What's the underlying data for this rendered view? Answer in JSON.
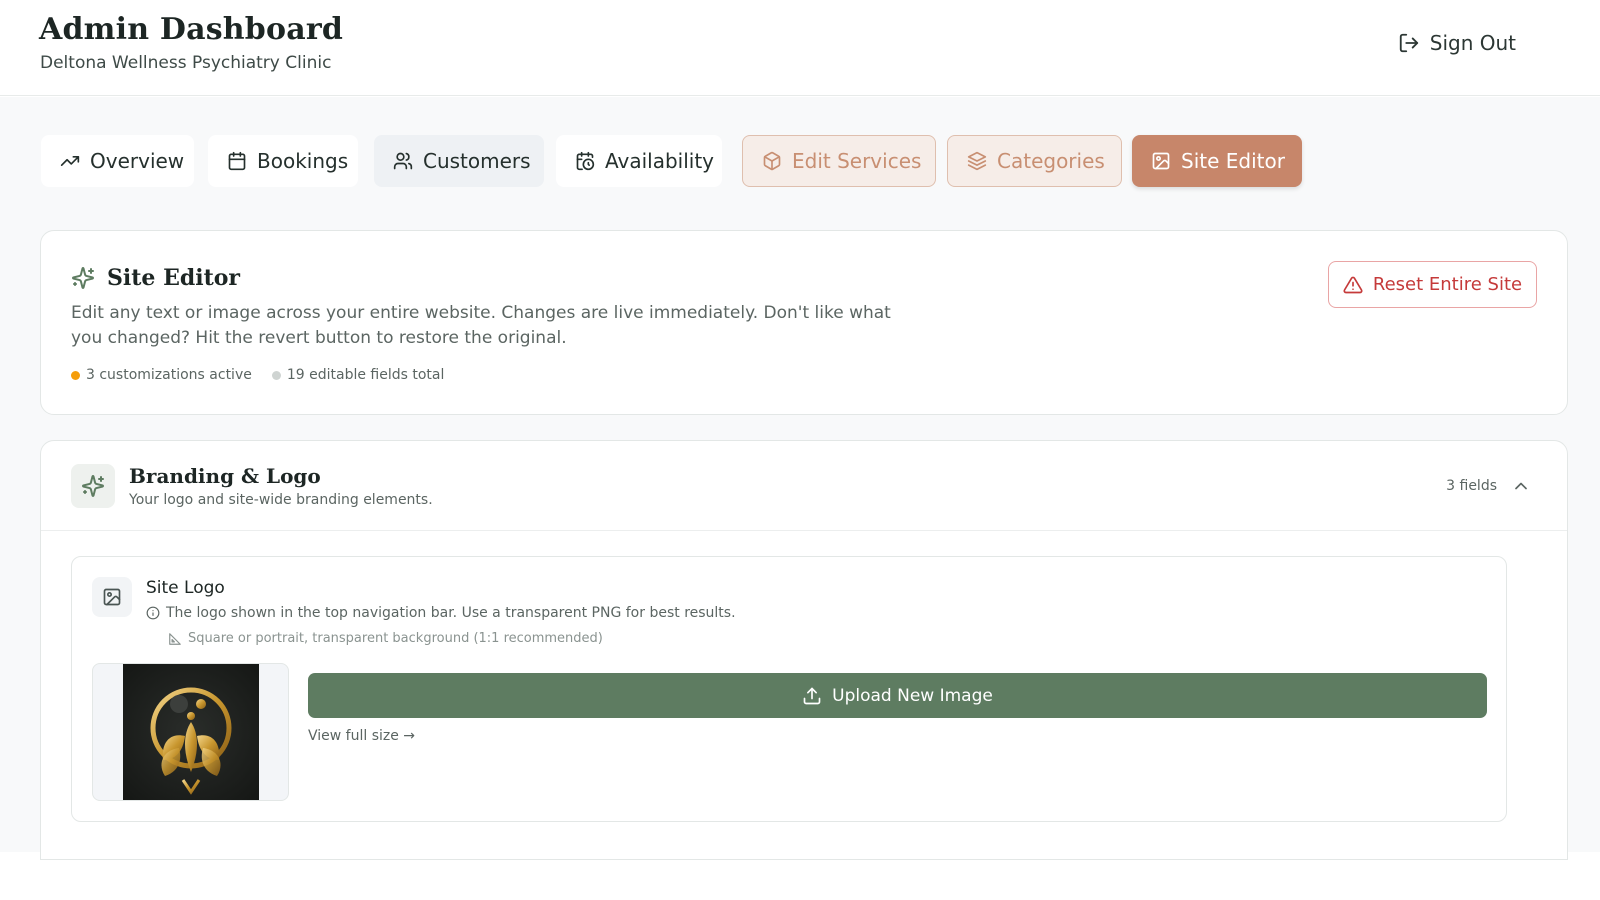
{
  "header": {
    "title": "Admin Dashboard",
    "subtitle": "Deltona Wellness Psychiatry Clinic",
    "sign_out_label": "Sign Out"
  },
  "tabs": [
    {
      "label": "Overview",
      "icon": "trending-up-icon",
      "state": "default"
    },
    {
      "label": "Bookings",
      "icon": "calendar-icon",
      "state": "default"
    },
    {
      "label": "Customers",
      "icon": "users-icon",
      "state": "hover"
    },
    {
      "label": "Availability",
      "icon": "calendar-clock-icon",
      "state": "default"
    },
    {
      "label": "Edit Services",
      "icon": "package-icon",
      "state": "tinted"
    },
    {
      "label": "Categories",
      "icon": "layers-icon",
      "state": "tinted"
    },
    {
      "label": "Site Editor",
      "icon": "image-icon",
      "state": "active"
    }
  ],
  "site_editor": {
    "title": "Site Editor",
    "description": "Edit any text or image across your entire website. Changes are live immediately. Don't like what you changed? Hit the revert button to restore the original.",
    "stats": {
      "customizations": "3 customizations active",
      "fields_total": "19 editable fields total"
    },
    "reset_label": "Reset Entire Site"
  },
  "branding": {
    "title": "Branding & Logo",
    "subtitle": "Your logo and site-wide branding elements.",
    "field_count": "3 fields",
    "fields": {
      "site_logo": {
        "label": "Site Logo",
        "help": "The logo shown in the top navigation bar. Use a transparent PNG for best results.",
        "recommendation": "Square or portrait, transparent background (1:1 recommended)",
        "upload_label": "Upload New Image",
        "view_full_label": "View full size →"
      }
    }
  },
  "colors": {
    "accent": "#c7866a",
    "primary_green": "#5e7c61",
    "danger": "#c53a3a",
    "active_dot": "#f59e0b",
    "inactive_dot": "#cfd4d2"
  }
}
